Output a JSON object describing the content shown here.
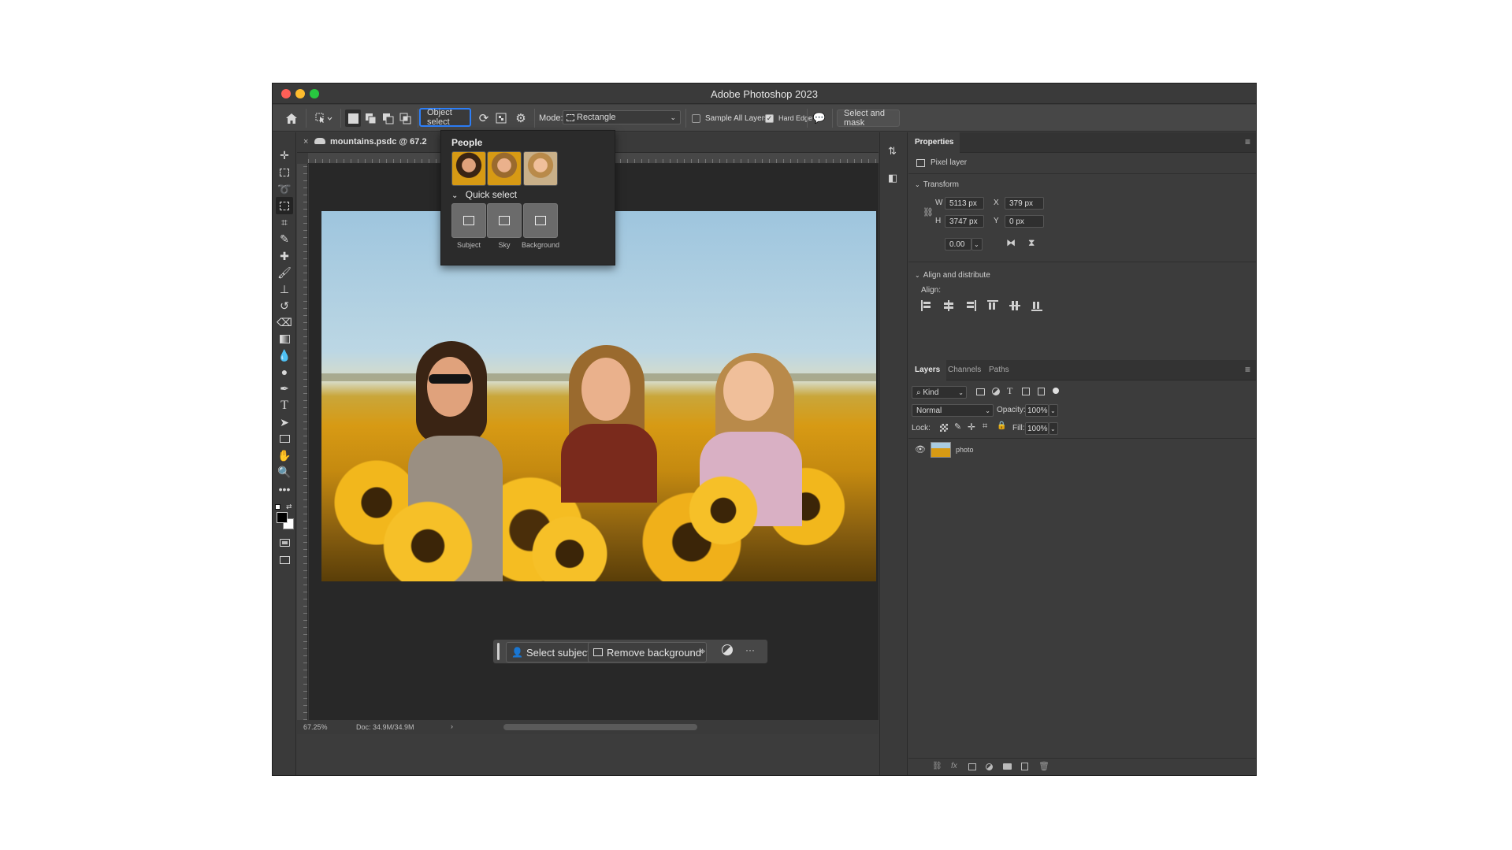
{
  "window": {
    "title": "Adobe Photoshop 2023"
  },
  "options_bar": {
    "object_select_label": "Object select",
    "mode_label": "Mode:",
    "mode_value": "Rectangle",
    "sample_all_layers": "Sample All Layers",
    "hard_edge": "Hard Edge",
    "select_and_mask": "Select and mask"
  },
  "document": {
    "tab_label": "mountains.psdc @ 67.2",
    "zoom": "67.25%",
    "doc_size": "Doc: 34.9M/34.9M",
    "status_arrow": "›"
  },
  "flyout": {
    "people_heading": "People",
    "quick_select_heading": "Quick select",
    "quick_select_items": [
      "Subject",
      "Sky",
      "Background"
    ]
  },
  "contextual_task_bar": {
    "select_subject": "Select subject",
    "remove_background": "Remove background",
    "more": "···"
  },
  "properties": {
    "tab": "Properties",
    "layer_type": "Pixel layer",
    "transform_heading": "Transform",
    "w_label": "W",
    "w_value": "5113 px",
    "h_label": "H",
    "h_value": "3747 px",
    "x_label": "X",
    "x_value": "379 px",
    "y_label": "Y",
    "y_value": "0 px",
    "angle_value": "0.00",
    "align_heading": "Align and distribute",
    "align_label": "Align:"
  },
  "layers": {
    "tabs": [
      "Layers",
      "Channels",
      "Paths"
    ],
    "filter_kind": "Kind",
    "blend_mode": "Normal",
    "opacity_label": "Opacity:",
    "opacity_value": "100%",
    "lock_label": "Lock:",
    "fill_label": "Fill:",
    "fill_value": "100%",
    "layer_name": "photo",
    "footer_fx": "fx"
  },
  "colors": {
    "close": "#ff5f57",
    "minimize": "#febc2e",
    "zoom": "#28c840",
    "accent": "#2d7ff9"
  }
}
